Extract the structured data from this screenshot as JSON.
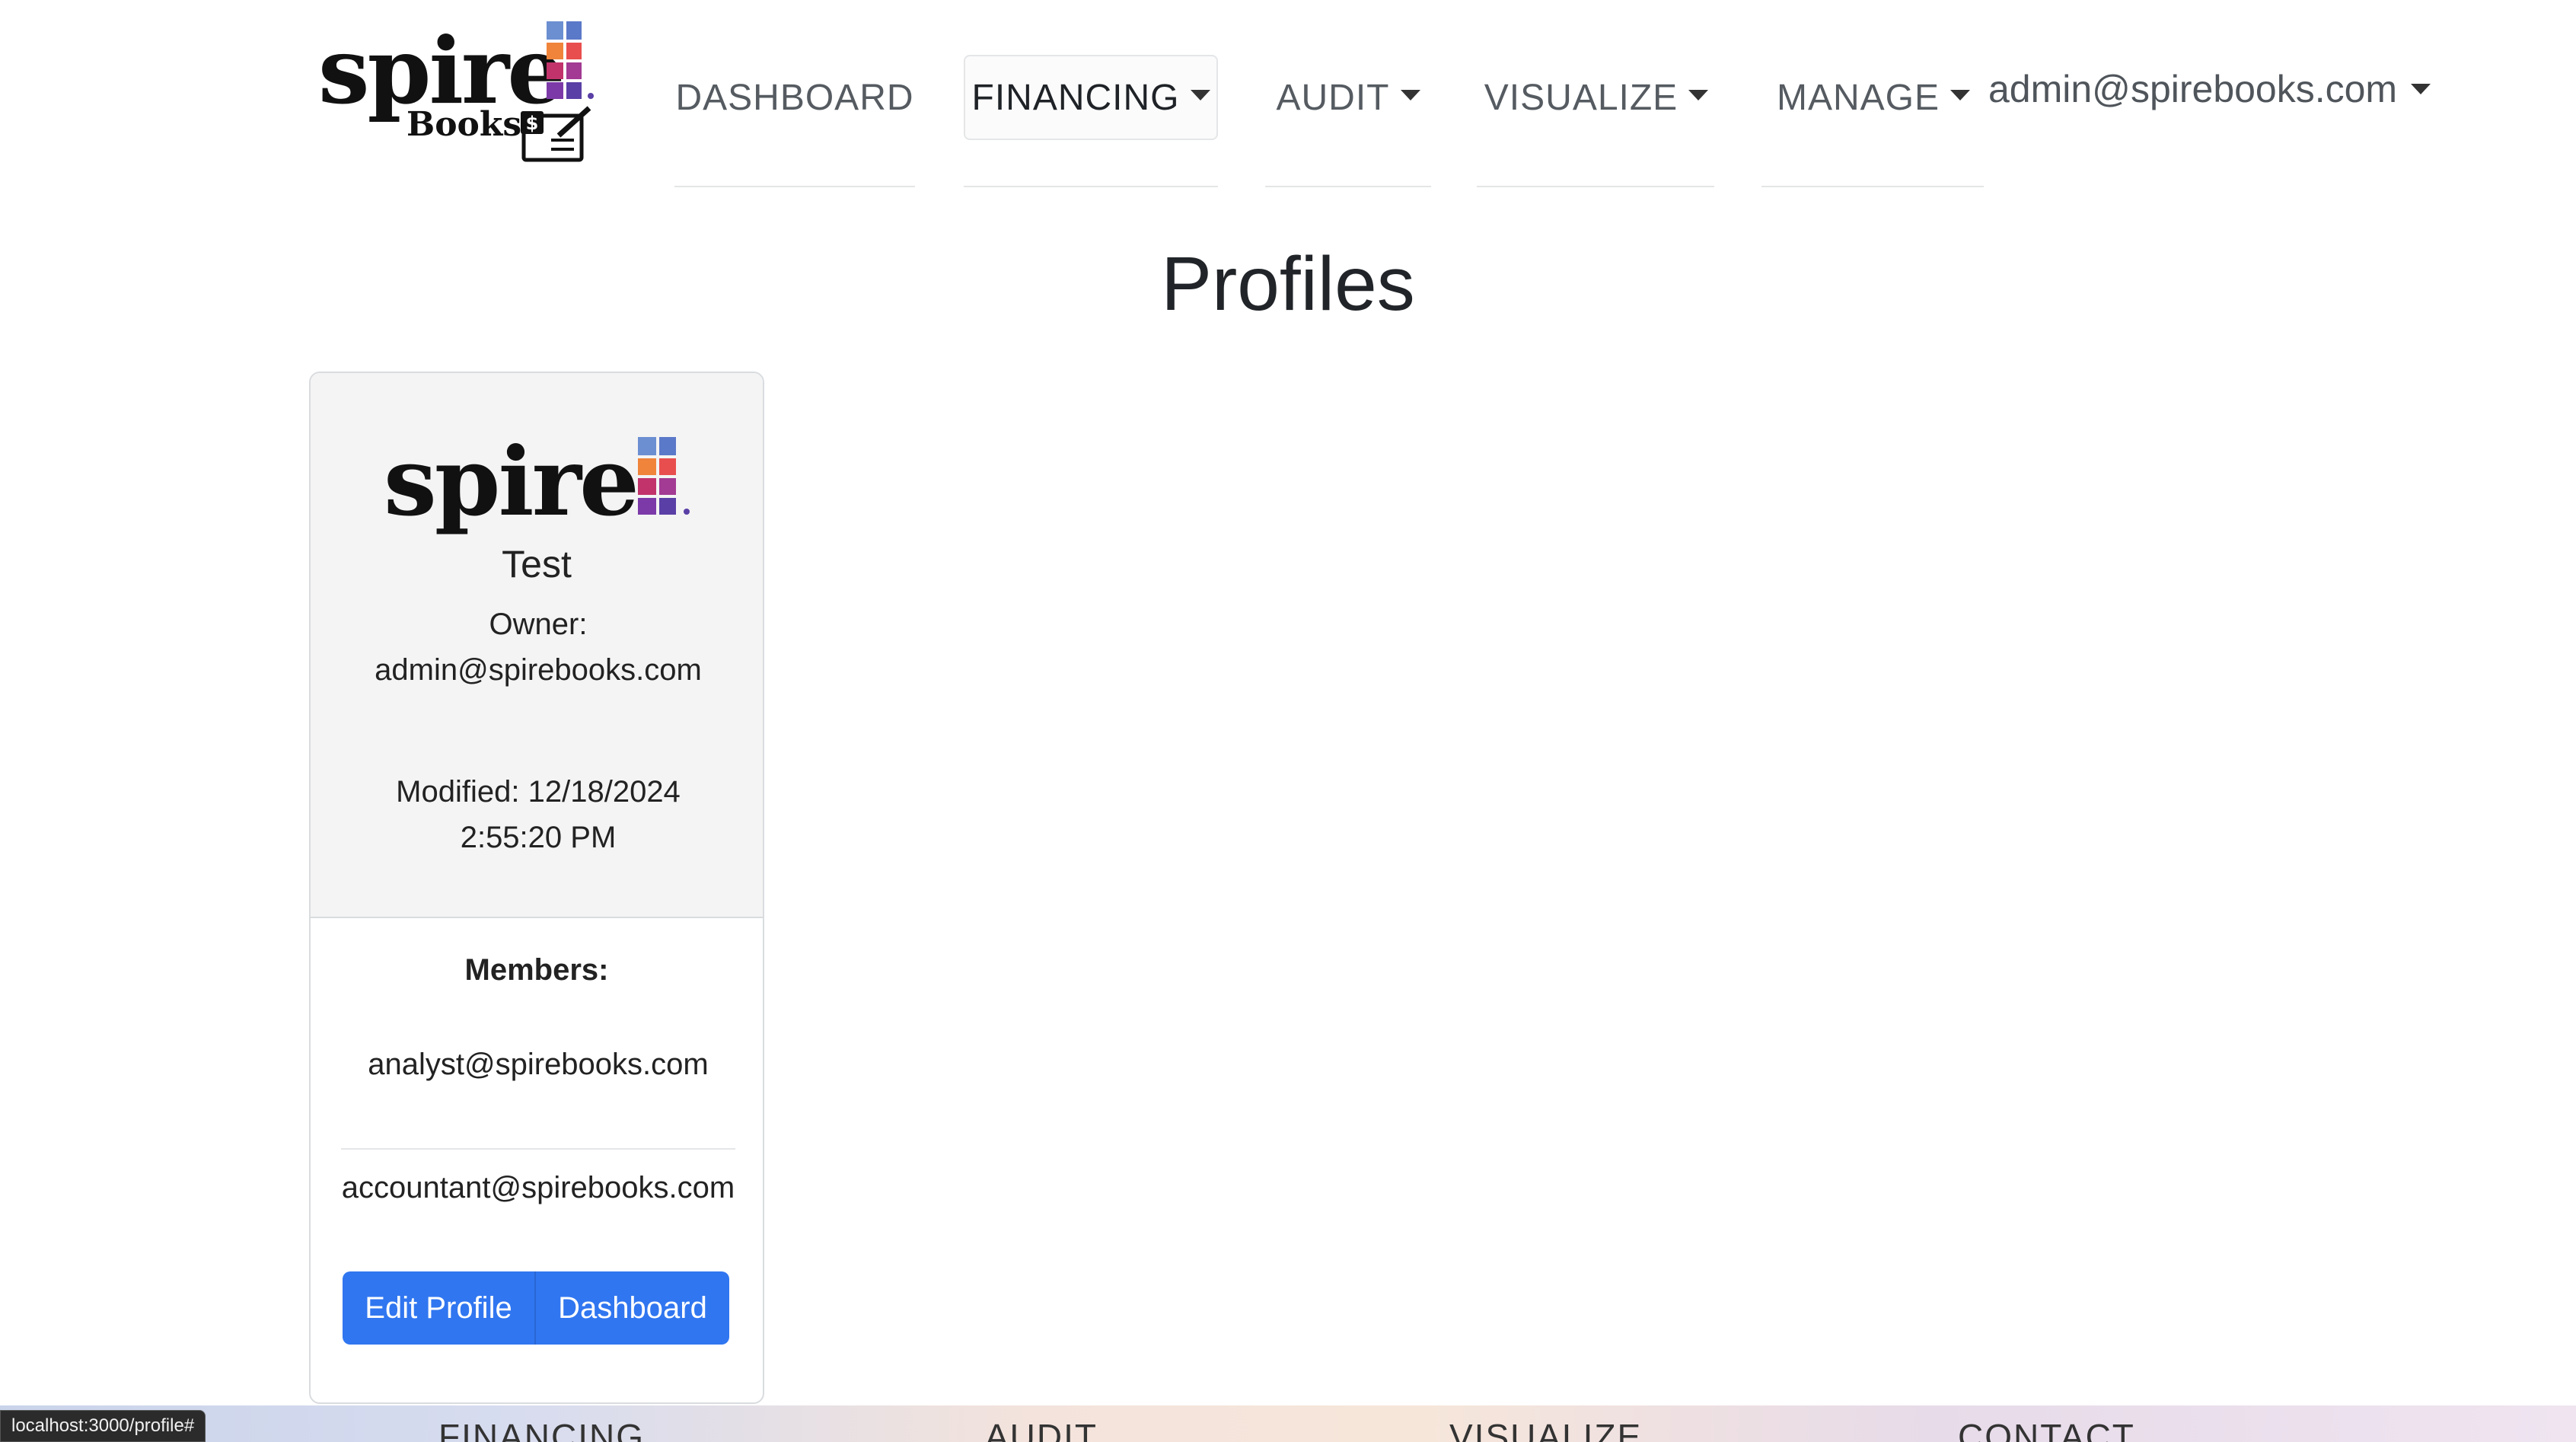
{
  "brand": {
    "name": "spire",
    "subname": "Books",
    "check_symbol": "$"
  },
  "nav": {
    "items": [
      {
        "label": "DASHBOARD",
        "dropdown": false,
        "active": false
      },
      {
        "label": "FINANCING",
        "dropdown": true,
        "active": true
      },
      {
        "label": "AUDIT",
        "dropdown": true,
        "active": false
      },
      {
        "label": "VISUALIZE",
        "dropdown": true,
        "active": false
      },
      {
        "label": "MANAGE",
        "dropdown": true,
        "active": false
      }
    ],
    "user": "admin@spirebooks.com"
  },
  "page": {
    "title": "Profiles"
  },
  "profile_card": {
    "logo_word": "spire",
    "name": "Test",
    "owner_label": "Owner:",
    "owner_value": "admin@spirebooks.com",
    "modified_label": "Modified:",
    "modified_value": "12/18/2024 2:55:20 PM",
    "members_label": "Members:",
    "members": [
      "analyst@spirebooks.com",
      "accountant@spirebooks.com"
    ],
    "edit_button": "Edit Profile",
    "dashboard_button": "Dashboard"
  },
  "footer": {
    "links": [
      "FINANCING",
      "AUDIT",
      "VISUALIZE",
      "CONTACT"
    ]
  },
  "status_bar": {
    "url": "localhost:3000/profile#"
  },
  "colors": {
    "primary_button": "#3076f0",
    "logo_blue": "#6b8fd1",
    "logo_orange": "#f0843b",
    "logo_magenta": "#c2336b",
    "logo_purple": "#7c3aa8"
  }
}
